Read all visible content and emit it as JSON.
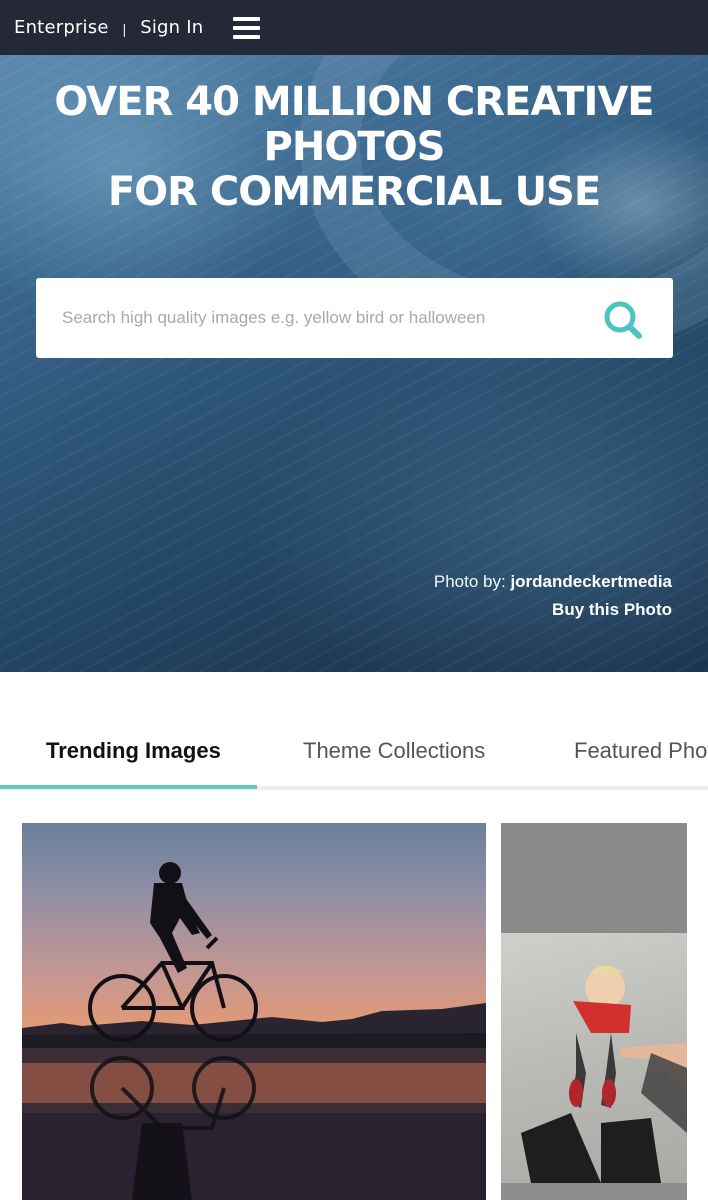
{
  "nav": {
    "enterprise": "Enterprise",
    "separator": "|",
    "sign_in": "Sign In",
    "menu_icon": "hamburger-menu-icon"
  },
  "hero": {
    "title_lines": [
      "OVER 40 MILLION CREATIVE",
      "PHOTOS",
      "FOR COMMERCIAL USE"
    ],
    "search_placeholder": "Search high quality images e.g. yellow bird or halloween",
    "search_value": "",
    "search_icon": "search-icon",
    "credit_prefix": "Photo by: ",
    "credit_author": "jordandeckertmedia",
    "buy_link": "Buy this Photo"
  },
  "tabs": [
    {
      "label": "Trending Images",
      "active": true
    },
    {
      "label": "Theme Collections",
      "active": false
    },
    {
      "label": "Featured Photographers",
      "active": false
    }
  ],
  "colors": {
    "nav_bg": "#252836",
    "accent": "#5cc8c4",
    "search_icon": "#4cc4bf"
  }
}
